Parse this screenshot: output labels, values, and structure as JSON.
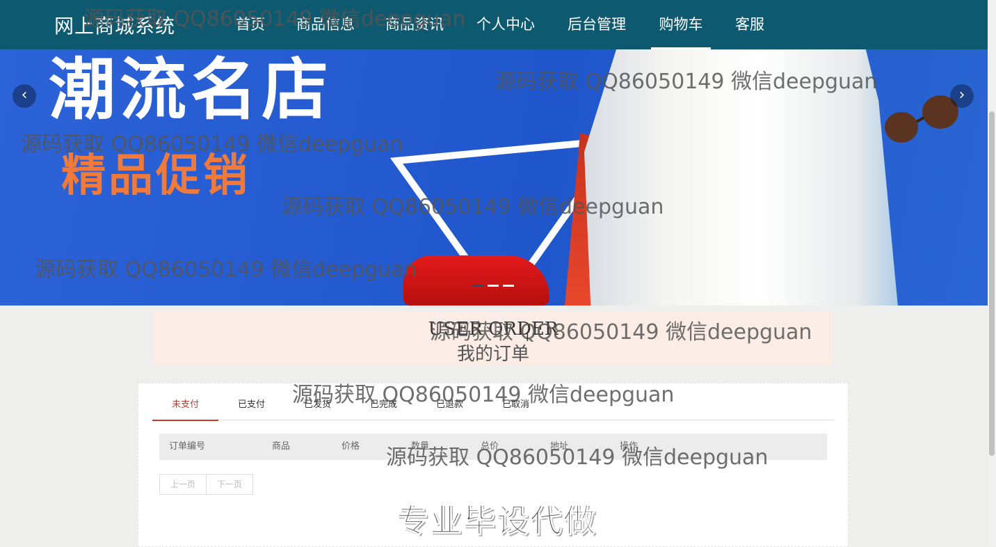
{
  "nav": {
    "brand": "网上商城系统",
    "items": [
      "首页",
      "商品信息",
      "商品资讯",
      "个人中心",
      "后台管理",
      "购物车",
      "客服"
    ],
    "active": "购物车"
  },
  "banner": {
    "headline": "潮流名店",
    "subline": "精品促销",
    "prev_icon": "chevron-left-icon",
    "next_icon": "chevron-right-icon",
    "slides": 3,
    "active_slide": 1
  },
  "order": {
    "title_en": "USER ORDER",
    "title_cn": "我的订单",
    "tabs": [
      "未支付",
      "已支付",
      "已发货",
      "已完成",
      "已退款",
      "已取消"
    ],
    "active_tab": "未支付",
    "columns": [
      "订单编号",
      "商品",
      "价格",
      "数量",
      "总价",
      "地址",
      "操作"
    ],
    "prev_page": "上一页",
    "next_page": "下一页"
  },
  "overlay": {
    "watermark": "源码获取 QQ86050149 微信deepguan",
    "stamp": "专业毕设代做"
  },
  "colors": {
    "nav_bg": "#0d5a70",
    "accent": "#c0392b",
    "order_head_bg": "#fbede6"
  }
}
